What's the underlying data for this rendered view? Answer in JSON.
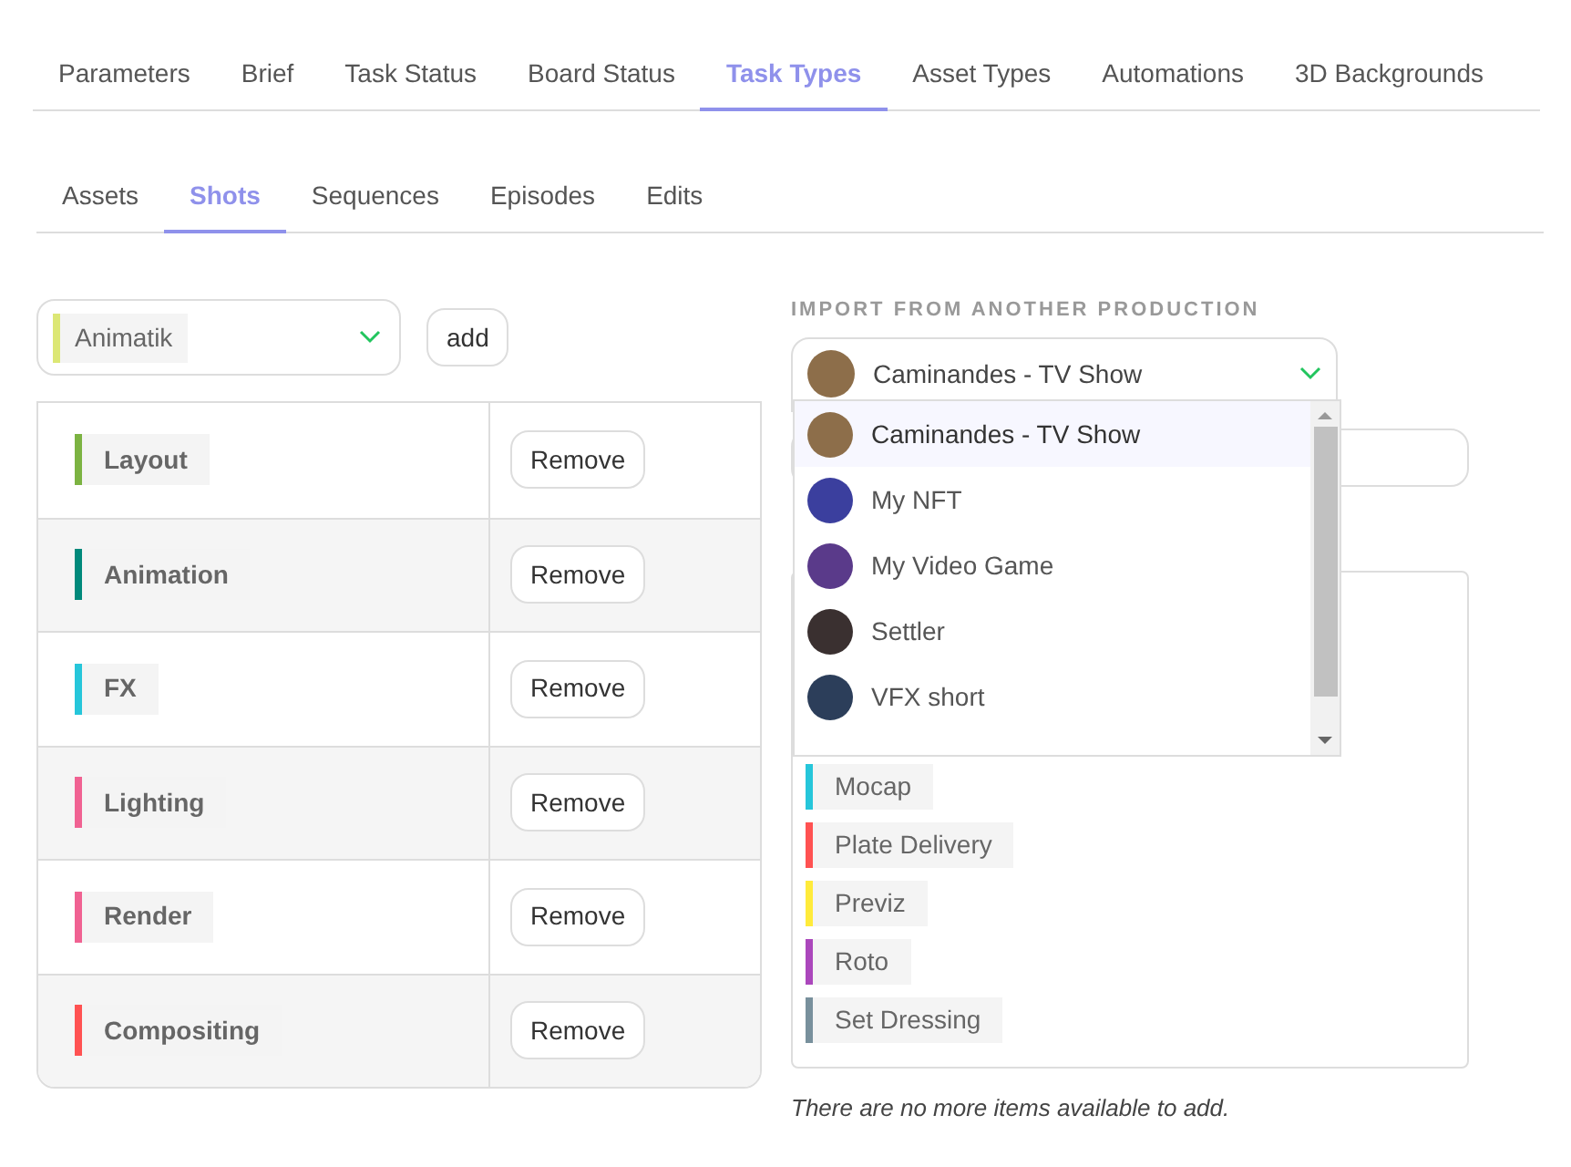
{
  "tabs": [
    {
      "label": "Parameters",
      "selected": false
    },
    {
      "label": "Brief",
      "selected": false
    },
    {
      "label": "Task Status",
      "selected": false
    },
    {
      "label": "Board Status",
      "selected": false
    },
    {
      "label": "Task Types",
      "selected": true
    },
    {
      "label": "Asset Types",
      "selected": false
    },
    {
      "label": "Automations",
      "selected": false
    },
    {
      "label": "3D Backgrounds",
      "selected": false
    }
  ],
  "subtabs": [
    {
      "label": "Assets",
      "selected": false
    },
    {
      "label": "Shots",
      "selected": true
    },
    {
      "label": "Sequences",
      "selected": false
    },
    {
      "label": "Episodes",
      "selected": false
    },
    {
      "label": "Edits",
      "selected": false
    }
  ],
  "task_type_select": {
    "value": "Animatik",
    "color": "#dce775"
  },
  "add_button": "add",
  "task_types": [
    {
      "name": "Layout",
      "color": "#7cb342",
      "action": "Remove"
    },
    {
      "name": "Animation",
      "color": "#00897b",
      "action": "Remove"
    },
    {
      "name": "FX",
      "color": "#26c6da",
      "action": "Remove"
    },
    {
      "name": "Lighting",
      "color": "#f06292",
      "action": "Remove"
    },
    {
      "name": "Render",
      "color": "#f06292",
      "action": "Remove"
    },
    {
      "name": "Compositing",
      "color": "#ff5252",
      "action": "Remove"
    }
  ],
  "import": {
    "label": "IMPORT FROM ANOTHER PRODUCTION",
    "value": "Caminandes - TV Show",
    "expanded": true,
    "options": [
      {
        "label": "Caminandes - TV Show",
        "selected": true
      },
      {
        "label": "My NFT",
        "selected": false
      },
      {
        "label": "My Video Game",
        "selected": false
      },
      {
        "label": "Settler",
        "selected": false
      },
      {
        "label": "VFX short",
        "selected": false
      }
    ]
  },
  "available_task_types": [
    {
      "name": "Mocap",
      "color": "#26c6da"
    },
    {
      "name": "Plate Delivery",
      "color": "#ff5252"
    },
    {
      "name": "Previz",
      "color": "#ffeb3b"
    },
    {
      "name": "Roto",
      "color": "#ab47bc"
    },
    {
      "name": "Set Dressing",
      "color": "#78909c"
    }
  ],
  "note": "There are no more items available to add."
}
